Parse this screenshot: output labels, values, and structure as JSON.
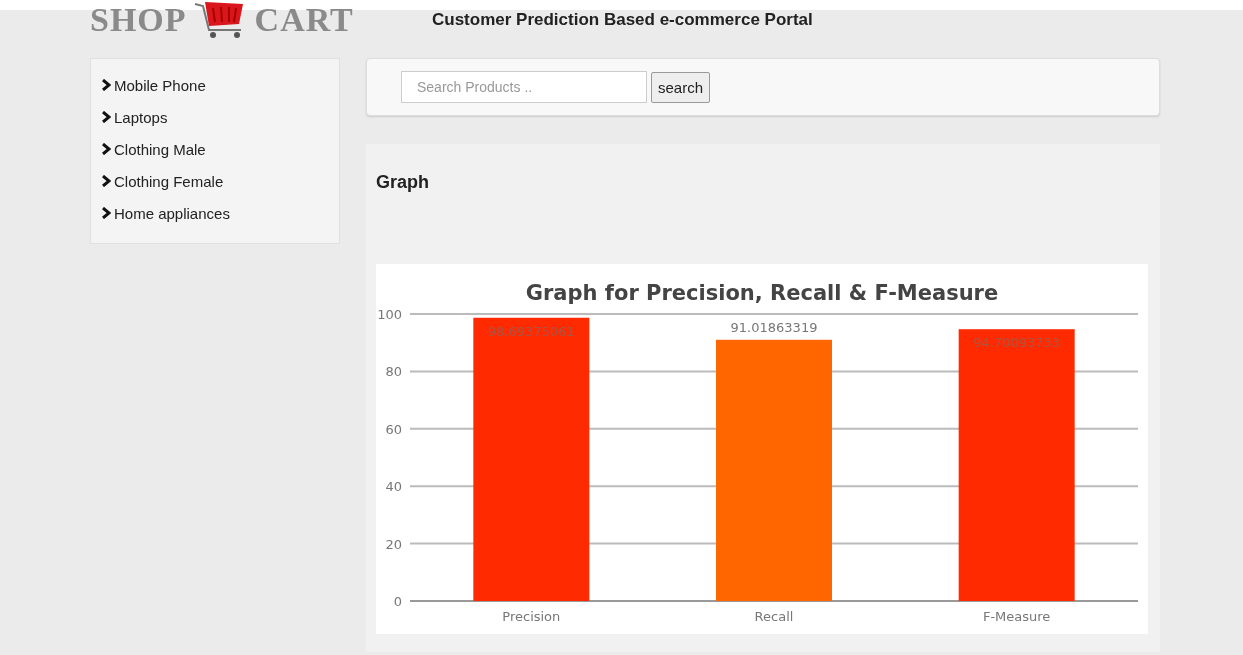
{
  "header": {
    "logo_left": "SHOP",
    "logo_right": "CART",
    "title": "Customer Prediction Based e-commerce Portal"
  },
  "sidebar": {
    "items": [
      {
        "label": "Mobile Phone"
      },
      {
        "label": "Laptops"
      },
      {
        "label": "Clothing Male"
      },
      {
        "label": "Clothing Female"
      },
      {
        "label": "Home appliances"
      }
    ]
  },
  "search": {
    "placeholder": "Search Products ..",
    "button": "search"
  },
  "graph_panel": {
    "heading": "Graph",
    "chart_data": {
      "type": "bar",
      "title": "Graph for Precision, Recall & F-Measure",
      "categories": [
        "Precision",
        "Recall",
        "F-Measure"
      ],
      "series": [
        {
          "color": "#ff2a00",
          "values": [
            98.69375061,
            null,
            94.70093733
          ]
        },
        {
          "color": "#ff6600",
          "values": [
            null,
            91.01863319,
            null
          ]
        }
      ],
      "stacked": true,
      "grid": true,
      "ylim": [
        0,
        100
      ],
      "yticks": [
        0,
        20,
        40,
        60,
        80,
        100
      ],
      "data_labels": true,
      "value_labels": [
        "98.69375061",
        "91.01863319",
        "94.70093733"
      ]
    }
  }
}
